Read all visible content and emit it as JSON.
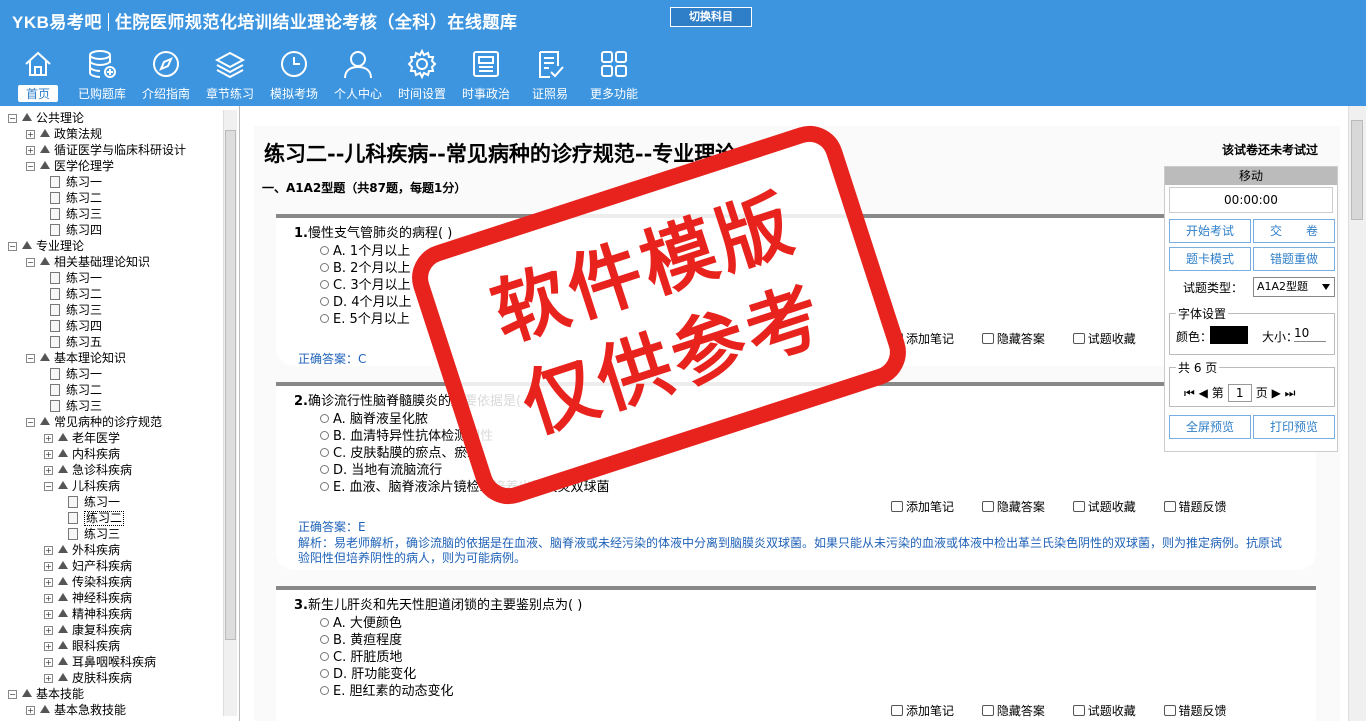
{
  "header": {
    "logo": "YKB易考吧",
    "title": "住院医师规范化培训结业理论考核（全科）在线题库",
    "switch_label": "切换科目"
  },
  "nav": [
    {
      "label": "首页",
      "icon": "home-icon"
    },
    {
      "label": "已购题库",
      "icon": "database-icon"
    },
    {
      "label": "介绍指南",
      "icon": "compass-icon"
    },
    {
      "label": "章节练习",
      "icon": "layers-icon"
    },
    {
      "label": "模拟考场",
      "icon": "clock-icon"
    },
    {
      "label": "个人中心",
      "icon": "user-icon"
    },
    {
      "label": "时间设置",
      "icon": "gear-icon"
    },
    {
      "label": "时事政治",
      "icon": "news-icon"
    },
    {
      "label": "证照易",
      "icon": "checklist-icon"
    },
    {
      "label": "更多功能",
      "icon": "grid-icon"
    }
  ],
  "tree": [
    {
      "label": "公共理论",
      "depth": 0,
      "kind": "folder"
    },
    {
      "label": "政策法规",
      "depth": 1,
      "kind": "folder"
    },
    {
      "label": "循证医学与临床科研设计",
      "depth": 1,
      "kind": "folder"
    },
    {
      "label": "医学伦理学",
      "depth": 1,
      "kind": "folder"
    },
    {
      "label": "练习一",
      "depth": 2,
      "kind": "doc"
    },
    {
      "label": "练习二",
      "depth": 2,
      "kind": "doc"
    },
    {
      "label": "练习三",
      "depth": 2,
      "kind": "doc"
    },
    {
      "label": "练习四",
      "depth": 2,
      "kind": "doc"
    },
    {
      "label": "专业理论",
      "depth": 0,
      "kind": "folder"
    },
    {
      "label": "相关基础理论知识",
      "depth": 1,
      "kind": "folder"
    },
    {
      "label": "练习一",
      "depth": 2,
      "kind": "doc"
    },
    {
      "label": "练习二",
      "depth": 2,
      "kind": "doc"
    },
    {
      "label": "练习三",
      "depth": 2,
      "kind": "doc"
    },
    {
      "label": "练习四",
      "depth": 2,
      "kind": "doc"
    },
    {
      "label": "练习五",
      "depth": 2,
      "kind": "doc"
    },
    {
      "label": "基本理论知识",
      "depth": 1,
      "kind": "folder"
    },
    {
      "label": "练习一",
      "depth": 2,
      "kind": "doc"
    },
    {
      "label": "练习二",
      "depth": 2,
      "kind": "doc"
    },
    {
      "label": "练习三",
      "depth": 2,
      "kind": "doc"
    },
    {
      "label": "常见病种的诊疗规范",
      "depth": 1,
      "kind": "folder"
    },
    {
      "label": "老年医学",
      "depth": 2,
      "kind": "folder"
    },
    {
      "label": "内科疾病",
      "depth": 2,
      "kind": "folder"
    },
    {
      "label": "急诊科疾病",
      "depth": 2,
      "kind": "folder"
    },
    {
      "label": "儿科疾病",
      "depth": 2,
      "kind": "folder"
    },
    {
      "label": "练习一",
      "depth": 3,
      "kind": "doc"
    },
    {
      "label": "练习二",
      "depth": 3,
      "kind": "doc",
      "selected": true
    },
    {
      "label": "练习三",
      "depth": 3,
      "kind": "doc"
    },
    {
      "label": "外科疾病",
      "depth": 2,
      "kind": "folder"
    },
    {
      "label": "妇产科疾病",
      "depth": 2,
      "kind": "folder"
    },
    {
      "label": "传染科疾病",
      "depth": 2,
      "kind": "folder"
    },
    {
      "label": "神经科疾病",
      "depth": 2,
      "kind": "folder"
    },
    {
      "label": "精神科疾病",
      "depth": 2,
      "kind": "folder"
    },
    {
      "label": "康复科疾病",
      "depth": 2,
      "kind": "folder"
    },
    {
      "label": "眼科疾病",
      "depth": 2,
      "kind": "folder"
    },
    {
      "label": "耳鼻咽喉科疾病",
      "depth": 2,
      "kind": "folder"
    },
    {
      "label": "皮肤科疾病",
      "depth": 2,
      "kind": "folder"
    },
    {
      "label": "基本技能",
      "depth": 0,
      "kind": "folder"
    },
    {
      "label": "基本急救技能",
      "depth": 1,
      "kind": "folder"
    }
  ],
  "paper": {
    "title": "练习二--儿科疾病--常见病种的诊疗规范--专业理论",
    "status": "该试卷还未考试过",
    "section": "一、A1A2型题（共87题，每题1分）"
  },
  "tools": {
    "note": "添加笔记",
    "hide": "隐藏答案",
    "fav": "试题收藏",
    "report": "错题反馈"
  },
  "questions": [
    {
      "num": "1.",
      "text": "慢性支气管肺炎的病程( )",
      "options": [
        "A. 1个月以上",
        "B. 2个月以上",
        "C. 3个月以上",
        "D. 4个月以上",
        "E. 5个月以上"
      ],
      "answer": "正确答案：C"
    },
    {
      "num": "2.",
      "text": "确诊流行性脑脊髓膜炎的主要依据是( )",
      "options": [
        "A. 脑脊液呈化脓",
        "B. 血清特异性抗体检测阳性",
        "C. 皮肤黏膜的瘀点、瘀斑",
        "D. 当地有流脑流行",
        "E. 血液、脑脊液涂片镜检或培养出脑膜炎双球菌"
      ],
      "answer": "正确答案：E",
      "analysis": "解析：易老师解析，确诊流脑的依据是在血液、脑脊液或未经污染的体液中分离到脑膜炎双球菌。如果只能从未污染的血液或体液中检出革兰氏染色阴性的双球菌，则为推定病例。抗原试验阳性但培养阴性的病人，则为可能病例。"
    },
    {
      "num": "3.",
      "text": "新生儿肝炎和先天性胆道闭锁的主要鉴别点为( )",
      "options": [
        "A. 大便颜色",
        "B. 黄疸程度",
        "C. 肝脏质地",
        "D. 肝功能变化",
        "E. 胆红素的动态变化"
      ]
    }
  ],
  "panel": {
    "move": "移动",
    "timer": "00:00:00",
    "start_exam": "开始考试",
    "submit": "交　　卷",
    "card_mode": "题卡模式",
    "redo_wrong": "错题重做",
    "type_label": "试题类型：",
    "type_value": "A1A2型题",
    "font_legend": "字体设置",
    "color_label": "颜色：",
    "size_label": "大小：",
    "size_value": "10",
    "pages_legend": "共 6 页",
    "page_prefix": "第",
    "page_value": "1",
    "page_suffix": "页",
    "fullscreen": "全屏预览",
    "print": "打印预览"
  },
  "watermark": {
    "line1": "软件模版",
    "line2": "仅供参考"
  },
  "colors": {
    "header": "#3d95e0",
    "answer": "#1f62b8",
    "stamp": "#e8231e"
  }
}
